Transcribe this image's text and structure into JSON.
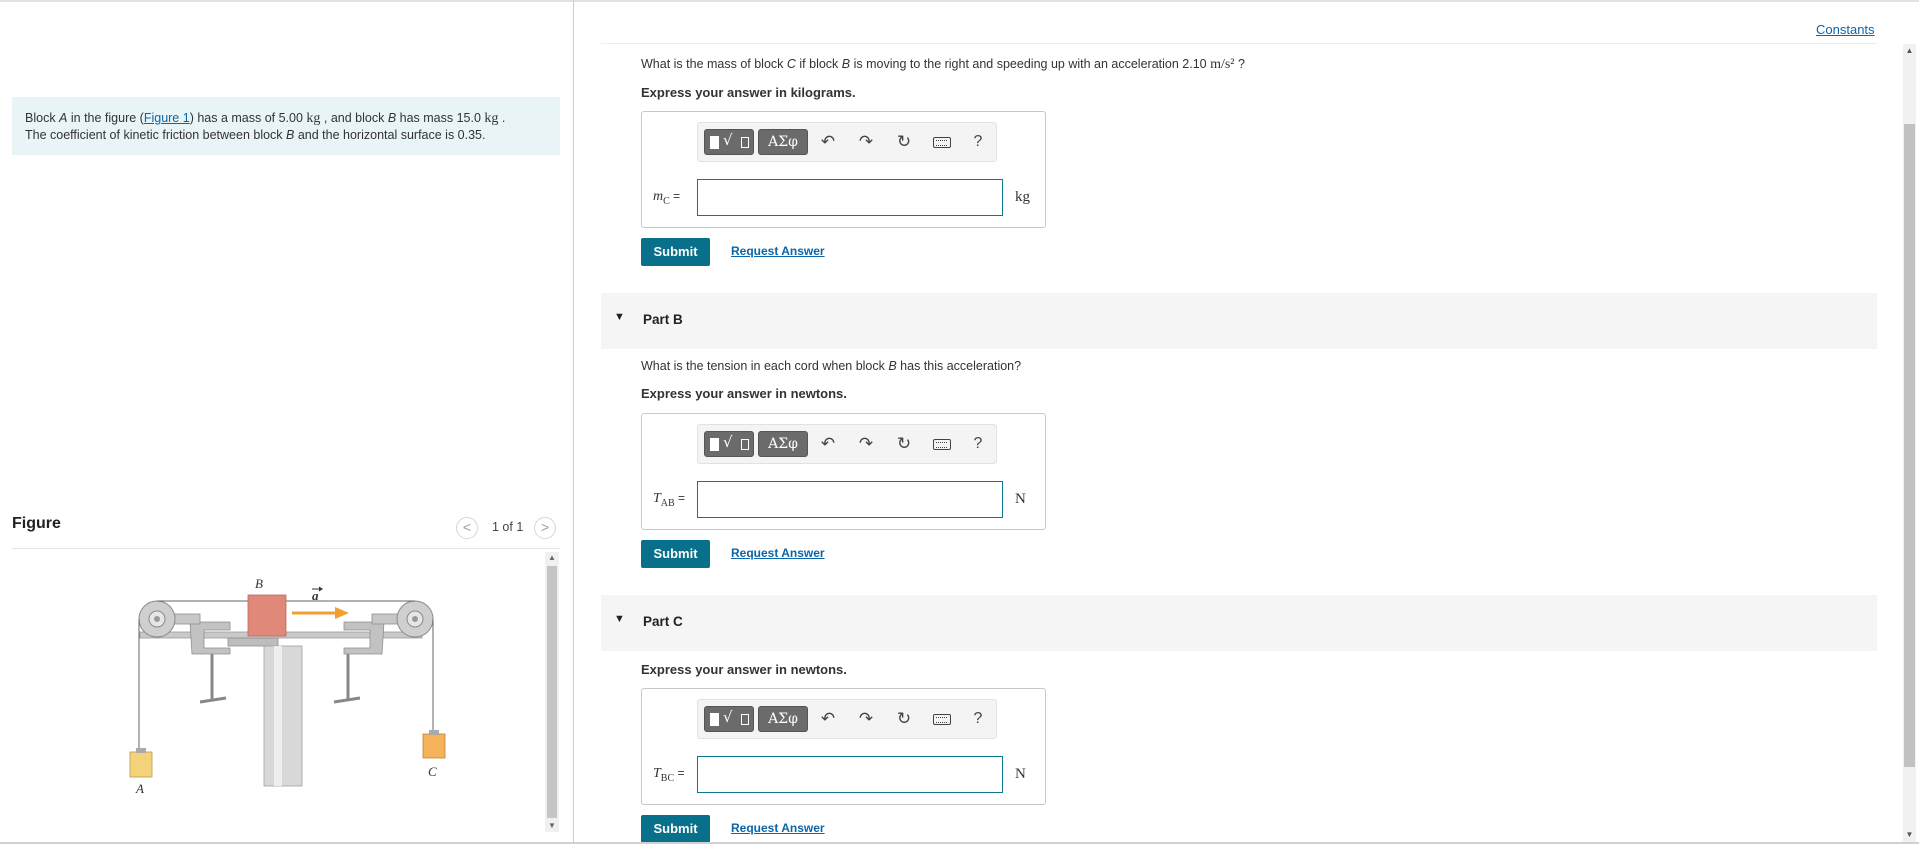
{
  "problem": {
    "t1": "Block ",
    "a": "A",
    "t2": " in the figure (",
    "figure_link": "Figure 1",
    "t3": ") has a mass of 5.00 ",
    "unit1": "kg",
    "t4": " , and block ",
    "b": "B",
    "t5": " has mass 15.0 ",
    "unit2": "kg",
    "t6": " .",
    "line2_a": "The coefficient of kinetic friction between block ",
    "line2_b": "B",
    "line2_c": " and the horizontal surface is 0.35."
  },
  "figure": {
    "title": "Figure",
    "pager_count": "1 of 1",
    "prev_glyph": "<",
    "next_glyph": ">",
    "labels": {
      "A": "A",
      "B": "B",
      "C": "C",
      "accel": "a"
    }
  },
  "constants_link": "Constants",
  "toolbar": {
    "greek": "ΑΣφ",
    "undo": "↶",
    "redo": "↷",
    "reset": "↻",
    "help": "?"
  },
  "part_a": {
    "q1": "What is the mass of block ",
    "q_c": "C",
    "q2": " if block ",
    "q_b": "B",
    "q3": " is moving to the right and speeding up with an acceleration 2.10 ",
    "q_unit": "m/s²",
    "q4": " ?",
    "express": "Express your answer in kilograms.",
    "var": "m",
    "var_sub": "C",
    "eq": " =",
    "unit": "kg",
    "submit": "Submit",
    "request": "Request Answer"
  },
  "part_b": {
    "title": "Part B",
    "q1": "What is the tension in each cord when block ",
    "q_b": "B",
    "q2": " has this acceleration?",
    "express": "Express your answer in newtons.",
    "var": "T",
    "var_sub": "AB",
    "eq": " =",
    "unit": "N",
    "submit": "Submit",
    "request": "Request Answer"
  },
  "part_c": {
    "title": "Part C",
    "express": "Express your answer in newtons.",
    "var": "T",
    "var_sub": "BC",
    "eq": " =",
    "unit": "N",
    "submit": "Submit",
    "request": "Request Answer"
  },
  "icons": {
    "caret": "caret-down-icon",
    "scroll_up": "▲",
    "scroll_down": "▼"
  }
}
